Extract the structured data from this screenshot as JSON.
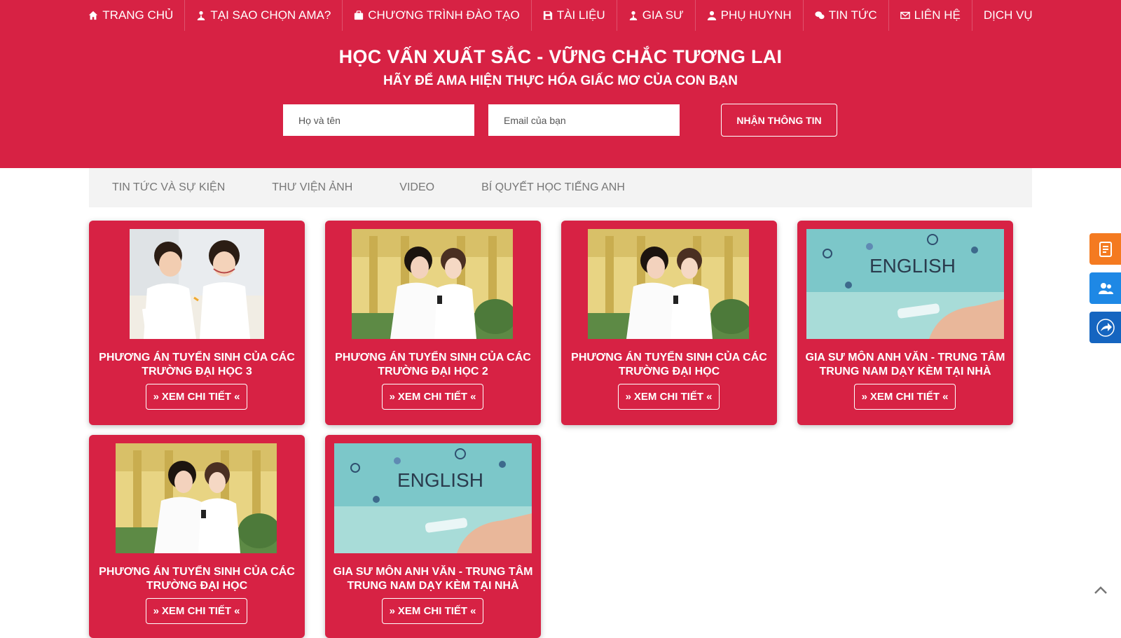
{
  "colors": {
    "brand_red": "#d72244",
    "tab_bg": "#f3f3f3",
    "tab_text": "#777777",
    "widget_orange": "#f47a20",
    "widget_blue": "#1e88e5",
    "widget_blue_dark": "#1565c0"
  },
  "nav": {
    "items": [
      {
        "label": "TRANG CHỦ",
        "icon": "home-icon"
      },
      {
        "label": "TẠI SAO CHỌN AMA?",
        "icon": "graduate-icon"
      },
      {
        "label": "CHƯƠNG TRÌNH ĐÀO TẠO",
        "icon": "briefcase-icon"
      },
      {
        "label": "TÀI LIỆU",
        "icon": "save-icon"
      },
      {
        "label": "GIA SƯ",
        "icon": "graduate-icon"
      },
      {
        "label": "PHỤ HUYNH",
        "icon": "user-icon"
      },
      {
        "label": "TIN TỨC",
        "icon": "chat-icon"
      },
      {
        "label": "LIÊN HỆ",
        "icon": "envelope-icon"
      },
      {
        "label": "DỊCH VỤ",
        "icon": ""
      }
    ]
  },
  "hero": {
    "title": "HỌC VẤN XUẤT SẮC - VỮNG CHẮC TƯƠNG LAI",
    "subtitle": "HÃY ĐỂ AMA HIỆN THỰC HÓA GIẤC MƠ CỦA CON BẠN"
  },
  "form": {
    "name_placeholder": "Họ và tên",
    "email_placeholder": "Email của bạn",
    "submit_label": "NHẬN THÔNG TIN"
  },
  "tabs": [
    {
      "label": "TIN TỨC VÀ SỰ KIỆN"
    },
    {
      "label": "THƯ VIỆN ẢNH"
    },
    {
      "label": "VIDEO"
    },
    {
      "label": "BÍ QUYẾT HỌC TIẾNG ANH"
    }
  ],
  "cards": [
    {
      "title": "PHƯƠNG ÁN TUYỂN SINH CỦA CÁC TRƯỜNG ĐẠI HỌC 3",
      "image": "children-drawing-photo",
      "button": "XEM CHI TIẾT"
    },
    {
      "title": "PHƯƠNG ÁN TUYỂN SINH CỦA CÁC TRƯỜNG ĐẠI HỌC 2",
      "image": "two-students-ao-dai-photo",
      "button": "XEM CHI TIẾT"
    },
    {
      "title": "PHƯƠNG ÁN TUYỂN SINH CỦA CÁC TRƯỜNG ĐẠI HỌC",
      "image": "two-students-ao-dai-photo",
      "button": "XEM CHI TIẾT"
    },
    {
      "title": "GIA SƯ MÔN ANH VĂN - TRUNG TÂM TRUNG NAM DẠY KÈM TẠI NHÀ",
      "image": "english-phone-photo",
      "button": "XEM CHI TIẾT",
      "image_caption": "ENGLISH"
    },
    {
      "title": "PHƯƠNG ÁN TUYỂN SINH CỦA CÁC TRƯỜNG ĐẠI HỌC",
      "image": "two-students-ao-dai-photo",
      "button": "XEM CHI TIẾT"
    },
    {
      "title": "GIA SƯ MÔN ANH VĂN - TRUNG TÂM TRUNG NAM DẠY KÈM TẠI NHÀ",
      "image": "english-phone-photo",
      "button": "XEM CHI TIẾT",
      "image_caption": "ENGLISH"
    }
  ],
  "widgets": [
    {
      "icon": "register-form-icon"
    },
    {
      "icon": "users-icon"
    },
    {
      "icon": "share-arrow-icon"
    }
  ],
  "scroll_top": {
    "icon": "chevron-up-icon"
  }
}
